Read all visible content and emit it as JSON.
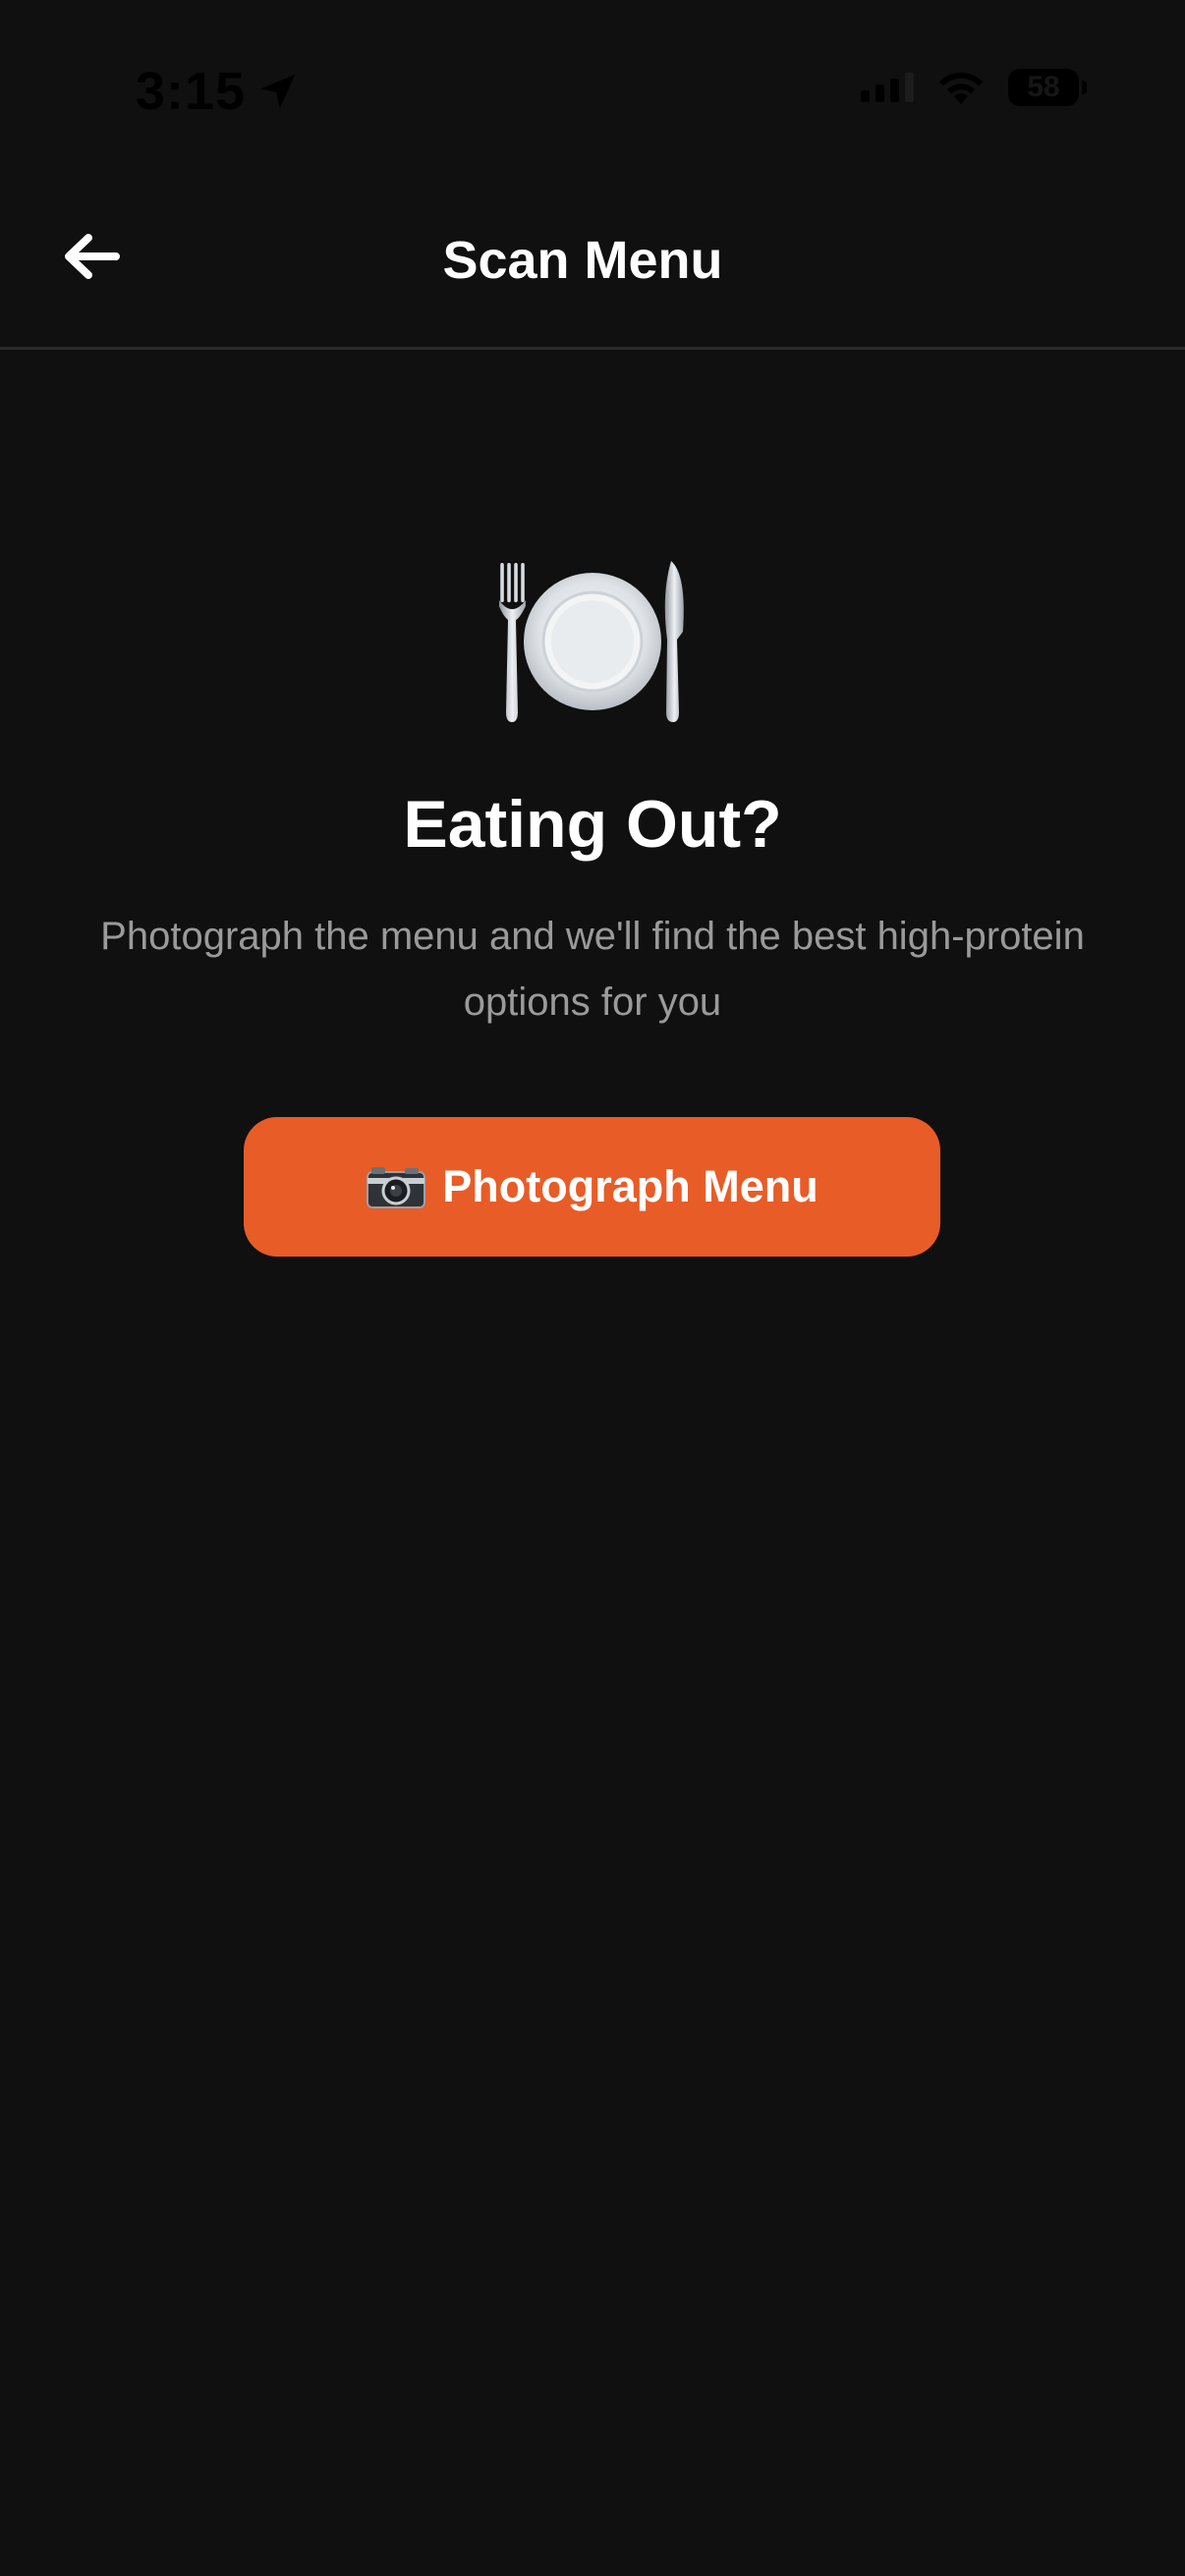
{
  "status_bar": {
    "time": "3:15",
    "battery": "58",
    "location_icon": "location-arrow-icon",
    "signal_icon": "cellular-signal-icon",
    "wifi_icon": "wifi-icon"
  },
  "header": {
    "title": "Scan Menu",
    "back_icon": "arrow-left-icon"
  },
  "hero": {
    "icon": "fork-knife-plate-icon",
    "title": "Eating Out?",
    "subtitle": "Photograph the menu and we'll find the best high-protein options for you"
  },
  "cta": {
    "icon": "camera-icon",
    "label": "Photograph Menu"
  },
  "colors": {
    "background": "#101010",
    "accent": "#e85c27",
    "subtitle": "#9a9a9a",
    "divider": "#2a2a2a"
  }
}
